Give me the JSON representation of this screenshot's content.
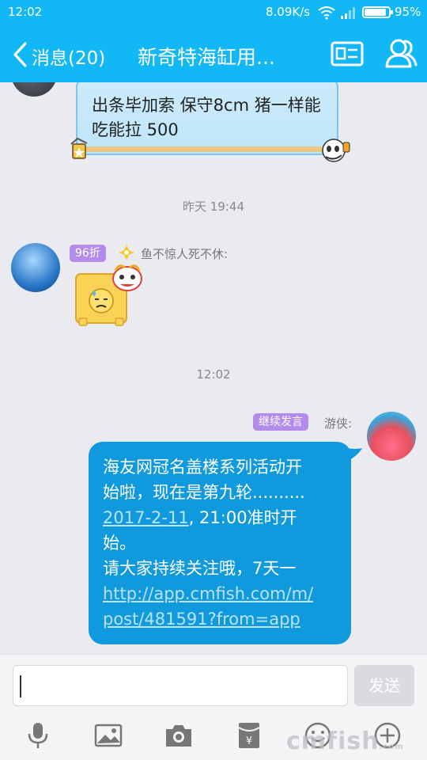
{
  "status": {
    "time": "12:02",
    "network_speed": "8.09K/s",
    "battery_percent": "95%",
    "battery_level": 0.95
  },
  "header": {
    "back_label": "消息(20)",
    "title": "新奇特海缸用..."
  },
  "messages": {
    "top_bubble_text": "出条毕加索 保守8cm 猪一样能吃能拉 500",
    "time_1": "昨天 19:44",
    "badge_1": "96折",
    "sender_1": "鱼不惊人死不休:",
    "time_2": "12:02",
    "badge_2": "继续发言",
    "sender_2": "游侠:",
    "main_lines": {
      "l1": "海友网冠名盖楼系列活动开",
      "l2": "始啦，现在是第九轮..........",
      "l3_link": "2017-2-11",
      "l3_rest": ", 21:00准时开",
      "l4": "始。",
      "l5": "请大家持续关注哦，7天一",
      "l6_link": "http://app.cmfish.com/m/",
      "l7_link": "post/481591?from=app"
    }
  },
  "input": {
    "placeholder": "",
    "send_label": "发送"
  },
  "toolbar": {
    "icons": [
      "microphone-icon",
      "image-icon",
      "camera-icon",
      "red-packet-icon",
      "emoji-icon",
      "plus-icon"
    ]
  },
  "watermark": {
    "text": "cmfish",
    "suffix": ".com"
  },
  "colors": {
    "header": "#12b7f5",
    "bubble": "#1199dd",
    "badge": "#b38be8",
    "background": "#eaebf0"
  }
}
